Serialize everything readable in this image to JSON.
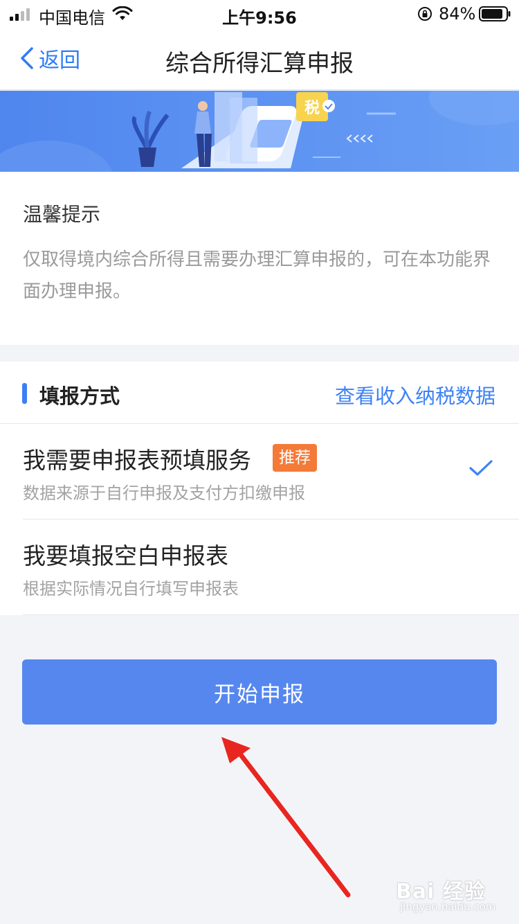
{
  "status_bar": {
    "carrier": "中国电信",
    "time": "上午9:56",
    "battery_pct": "84%"
  },
  "nav": {
    "back_label": "返回",
    "title": "综合所得汇算申报"
  },
  "banner": {
    "tax_badge": "税"
  },
  "notice": {
    "title": "温馨提示",
    "text": "仅取得境内综合所得且需要办理汇算申报的，可在本功能界面办理申报。"
  },
  "method": {
    "title": "填报方式",
    "link": "查看收入纳税数据",
    "options": [
      {
        "title": "我需要申报表预填服务",
        "badge": "推荐",
        "subtitle": "数据来源于自行申报及支付方扣缴申报",
        "selected": true
      },
      {
        "title": "我要填报空白申报表",
        "subtitle": "根据实际情况自行填写申报表",
        "selected": false
      }
    ]
  },
  "start_button": "开始申报",
  "watermark": {
    "main": "Bai 经验",
    "sub": "jingyan.baidu.com"
  },
  "colors": {
    "accent": "#3d82f5",
    "button": "#5587ef",
    "badge": "#f47a38",
    "arrow": "#e8261f"
  },
  "icons": [
    "signal-icon",
    "wifi-icon",
    "orientation-lock-icon",
    "battery-icon",
    "chevron-left-icon",
    "checkmark-icon",
    "annotation-arrow"
  ]
}
